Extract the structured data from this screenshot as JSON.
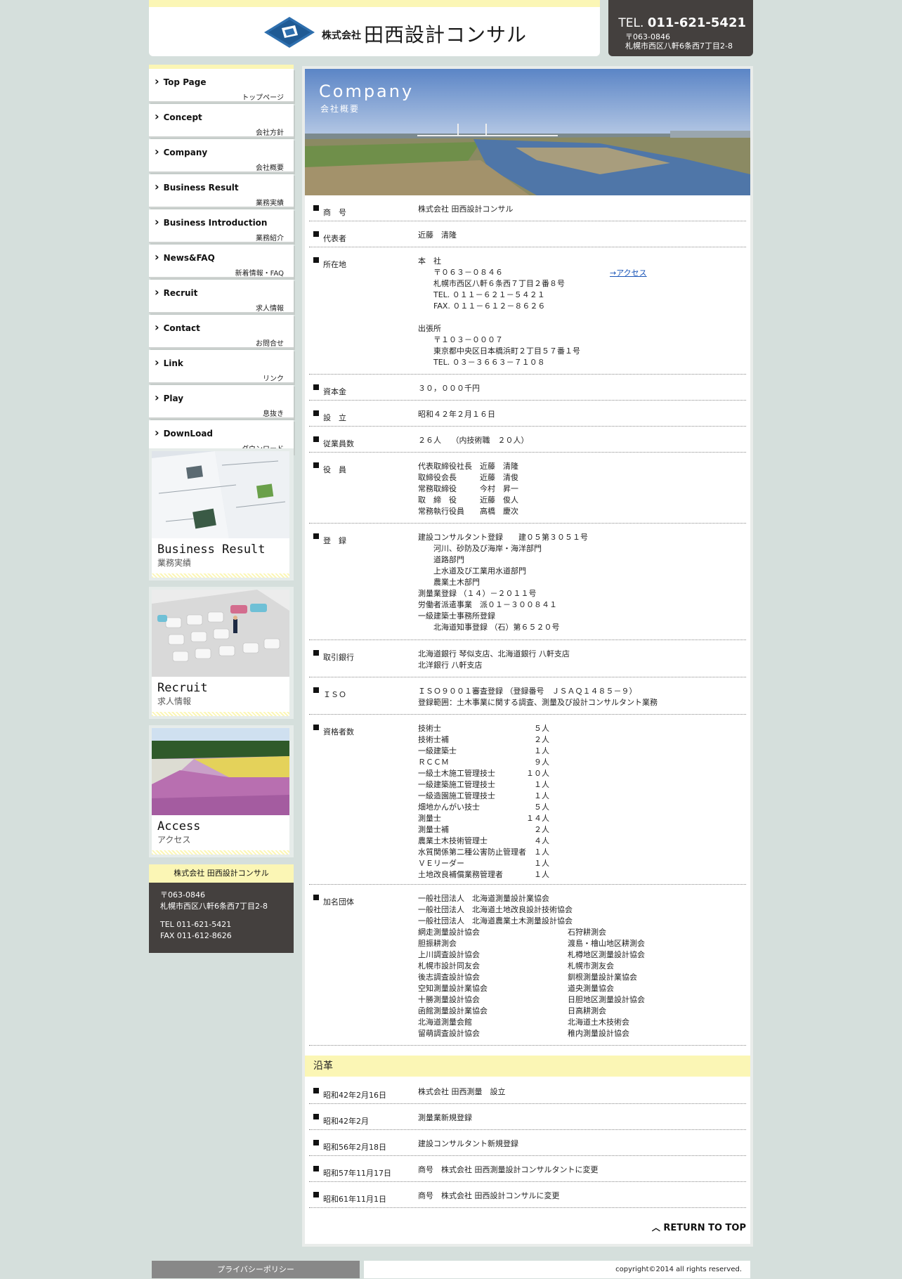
{
  "header": {
    "logo_small": "株式会社",
    "logo_big": "田西設計コンサル",
    "tel_prefix": "TEL.",
    "tel": "011-621-5421",
    "zip": "〒063-0846",
    "address": "札幌市西区八軒6条西7丁目2-8"
  },
  "nav": [
    {
      "en": "Top Page",
      "jp": "トップページ"
    },
    {
      "en": "Concept",
      "jp": "会社方針"
    },
    {
      "en": "Company",
      "jp": "会社概要"
    },
    {
      "en": "Business Result",
      "jp": "業務実績"
    },
    {
      "en": "Business Introduction",
      "jp": "業務紹介"
    },
    {
      "en": "News&FAQ",
      "jp": "新着情報・FAQ"
    },
    {
      "en": "Recruit",
      "jp": "求人情報"
    },
    {
      "en": "Contact",
      "jp": "お問合せ"
    },
    {
      "en": "Link",
      "jp": "リンク"
    },
    {
      "en": "Play",
      "jp": "息抜き"
    },
    {
      "en": "DownLoad",
      "jp": "ダウンロード"
    }
  ],
  "banners": [
    {
      "en": "Business Result",
      "jp": "業務実績"
    },
    {
      "en": "Recruit",
      "jp": "求人情報"
    },
    {
      "en": "Access",
      "jp": "アクセス"
    }
  ],
  "side_info": {
    "title": "株式会社 田西設計コンサル",
    "zip": "〒063-0846",
    "address": "札幌市西区八軒6条西7丁目2-8",
    "tel": "TEL 011-621-5421",
    "fax": "FAX 011-612-8626"
  },
  "hero": {
    "title": "Company",
    "subtitle": "会社概要"
  },
  "company": {
    "rows": [
      {
        "label": "商　号",
        "value": "株式会社 田西設計コンサル"
      },
      {
        "label": "代表者",
        "value": "近藤　清隆"
      },
      {
        "label": "所在地",
        "value": "本　社\n　　〒０６３－０８４６\n　　札幌市西区八軒６条西７丁目２番８号\n　　TEL. ０１１－６２１－５４２１\n　　FAX. ０１１－６１２－８６２６\n\n出張所\n　　〒１０３－０００７\n　　東京都中央区日本橋浜町２丁目５７番１号\n　　TEL. ０３－３６６３－７１０８",
        "link": "→アクセス"
      },
      {
        "label": "資本金",
        "value": "３０，０００千円"
      },
      {
        "label": "設　立",
        "value": "昭和４２年２月１６日"
      },
      {
        "label": "従業員数",
        "value": "２６人　 （内技術職　２０人）"
      },
      {
        "label": "役　員",
        "value": "代表取締役社長　近藤　清隆\n取締役会長　　　近藤　清俊\n常務取締役　　　今村　昇一\n取　締　役　　　近藤　俊人\n常務執行役員　　高橋　慶次"
      },
      {
        "label": "登　録",
        "value": "建設コンサルタント登録　　建０５第３０５１号\n　　河川、砂防及び海岸・海洋部門\n　　道路部門\n　　上水道及び工業用水道部門\n　　農業土木部門\n測量業登録 （１４）－２０１１号\n労働者派遣事業　派０１－３００８４１\n一級建築士事務所登録\n　　北海道知事登録 （石）第６５２０号"
      },
      {
        "label": "取引銀行",
        "value": "北海道銀行 琴似支店、北海道銀行 八軒支店\n北洋銀行 八軒支店"
      },
      {
        "label": "ＩＳＯ",
        "value": "ＩＳＯ９００１審査登録 （登録番号　ＪＳＡＱ１４８５－９）\n登録範囲：土木事業に関する調査、測量及び設計コンサルタント業務"
      },
      {
        "label": "資格者数",
        "value": "技術士　　　　　　　　　　　　５人\n技術士補　　　　　　　　　　　２人\n一級建築士　　　　　　　　　　１人\nＲＣＣＭ　　　　　　　　　　　９人\n一級土木施工管理技士　　　　１０人\n一級建築施工管理技士　　　　　１人\n一級造園施工管理技士　　　　　１人\n畑地かんがい技士　　　　　　　５人\n測量士　　　　　　　　　　　１４人\n測量士補　　　　　　　　　　　２人\n農業土木技術管理士　　　　　　４人\n水質関係第二種公害防止管理者　１人\nＶＥリーダー　　　　　　　　　１人\n土地改良補償業務管理者　　　　１人"
      },
      {
        "label": "加名団体",
        "value": "一般社団法人　北海道測量設計業協会\n一般社団法人　北海道土地改良設計技術協会\n一般社団法人　北海道農業土木測量設計協会\n網走測量設計協会\n胆振耕測会\n上川調査設計協会\n札幌市設計同友会\n後志調査設計協会\n空知測量設計業協会\n十勝測量設計協会\n函館測量設計業協会\n北海道測量会館\n留萌調査設計協会",
        "value2": "\n\n\n石狩耕測会\n渡島・檜山地区耕測会\n札樽地区測量設計協会\n札幌市測友会\n釧根測量設計業協会\n道央測量協会\n日胆地区測量設計協会\n日高耕測会\n北海道土木技術会\n稚内測量設計協会"
      }
    ]
  },
  "history": {
    "title": "沿革",
    "rows": [
      {
        "label": "昭和42年2月16日",
        "value": "株式会社 田西測量　設立"
      },
      {
        "label": "昭和42年2月",
        "value": "測量業新規登録"
      },
      {
        "label": "昭和56年2月18日",
        "value": "建設コンサルタント新規登録"
      },
      {
        "label": "昭和57年11月17日",
        "value": "商号　株式会社 田西測量設計コンサルタントに変更"
      },
      {
        "label": "昭和61年11月1日",
        "value": "商号　株式会社 田西設計コンサルに変更"
      }
    ]
  },
  "return_top": "RETURN TO TOP",
  "footer": {
    "privacy": "プライバシーポリシー",
    "copyright": "copyright©2014  all rights reserved."
  }
}
